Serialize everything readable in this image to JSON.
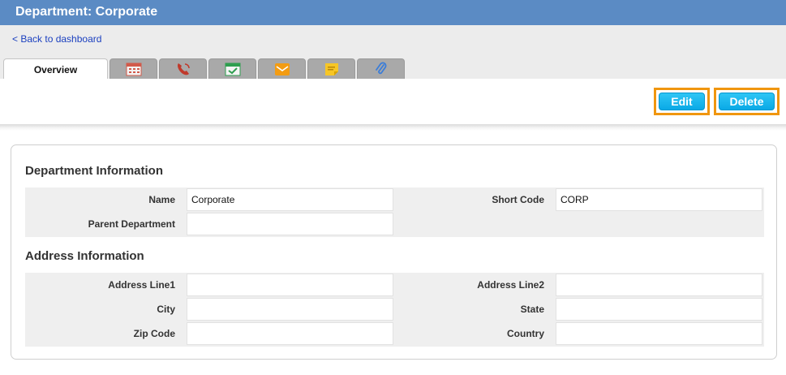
{
  "header": {
    "title": "Department: Corporate"
  },
  "nav": {
    "back_label": "< Back to dashboard"
  },
  "tabs": [
    {
      "label": "Overview",
      "icon": null
    },
    {
      "label": "",
      "icon": "calendar-icon"
    },
    {
      "label": "",
      "icon": "phone-icon"
    },
    {
      "label": "",
      "icon": "task-icon"
    },
    {
      "label": "",
      "icon": "email-icon"
    },
    {
      "label": "",
      "icon": "note-icon"
    },
    {
      "label": "",
      "icon": "attachment-icon"
    }
  ],
  "toolbar": {
    "edit_label": "Edit",
    "delete_label": "Delete",
    "accent": "#0aa9e6",
    "highlight": "#f0960f"
  },
  "department_info": {
    "heading": "Department Information",
    "name_label": "Name",
    "name_value": "Corporate",
    "short_code_label": "Short Code",
    "short_code_value": "CORP",
    "parent_label": "Parent Department",
    "parent_value": ""
  },
  "address_info": {
    "heading": "Address Information",
    "line1_label": "Address Line1",
    "line1_value": "",
    "line2_label": "Address Line2",
    "line2_value": "",
    "city_label": "City",
    "city_value": "",
    "state_label": "State",
    "state_value": "",
    "zip_label": "Zip Code",
    "zip_value": "",
    "country_label": "Country",
    "country_value": ""
  },
  "colors": {
    "header_bar": "#5b8bc4",
    "link": "#1a3fbf"
  }
}
